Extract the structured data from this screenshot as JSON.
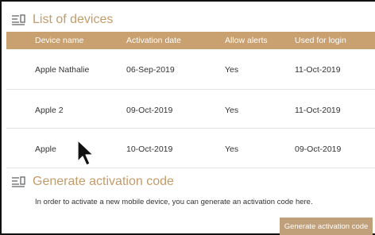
{
  "devices_section": {
    "title": "List of devices",
    "icon": "device-list-icon",
    "columns": [
      "Device name",
      "Activation date",
      "Allow alerts",
      "Used for login"
    ],
    "rows": [
      {
        "name": "Apple Nathalie",
        "activation_date": "06-Sep-2019",
        "allow_alerts": "Yes",
        "used_for_login": "11-Oct-2019"
      },
      {
        "name": "Apple 2",
        "activation_date": "09-Oct-2019",
        "allow_alerts": "Yes",
        "used_for_login": "11-Oct-2019"
      },
      {
        "name": "Apple",
        "activation_date": "10-Oct-2019",
        "allow_alerts": "Yes",
        "used_for_login": "09-Oct-2019"
      }
    ]
  },
  "generate_section": {
    "title": "Generate activation code",
    "icon": "device-list-icon",
    "info_text": "In order to activate a new mobile device, you can generate an activation code here.",
    "button_label": "Generate activation code"
  },
  "colors": {
    "accent": "#c39b6a",
    "header_bg": "#c9a06f",
    "button_bg": "#bfa07a"
  },
  "cursor_icon": "mouse-pointer-icon"
}
